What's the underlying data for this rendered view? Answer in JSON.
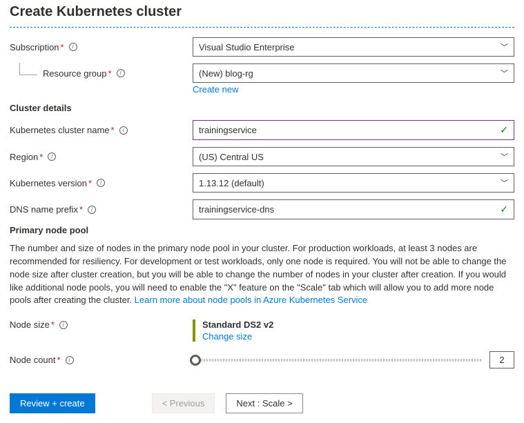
{
  "title": "Create Kubernetes cluster",
  "fields": {
    "subscription": {
      "label": "Subscription",
      "value": "Visual Studio Enterprise"
    },
    "resource_group": {
      "label": "Resource group",
      "value": "(New) blog-rg",
      "create_link": "Create new"
    },
    "cluster_name": {
      "label": "Kubernetes cluster name",
      "value": "trainingservice"
    },
    "region": {
      "label": "Region",
      "value": "(US) Central US"
    },
    "version": {
      "label": "Kubernetes version",
      "value": "1.13.12 (default)"
    },
    "dns_prefix": {
      "label": "DNS name prefix",
      "value": "trainingservice-dns"
    },
    "node_size": {
      "label": "Node size",
      "value": "Standard DS2 v2",
      "change_link": "Change size"
    },
    "node_count": {
      "label": "Node count",
      "value": "2"
    }
  },
  "sections": {
    "cluster_details": "Cluster details",
    "primary_pool": "Primary node pool"
  },
  "description": {
    "text": "The number and size of nodes in the primary node pool in your cluster. For production workloads, at least 3 nodes are recommended for resiliency. For development or test workloads, only one node is required. You will not be able to change the node size after cluster creation, but you will be able to change the number of nodes in your cluster after creation. If you would like additional node pools, you will need to enable the \"X\" feature on the \"Scale\" tab which will allow you to add more node pools after creating the cluster.",
    "link": "Learn more about node pools in Azure Kubernetes Service"
  },
  "footer": {
    "review": "Review + create",
    "previous": "< Previous",
    "next": "Next : Scale >"
  }
}
